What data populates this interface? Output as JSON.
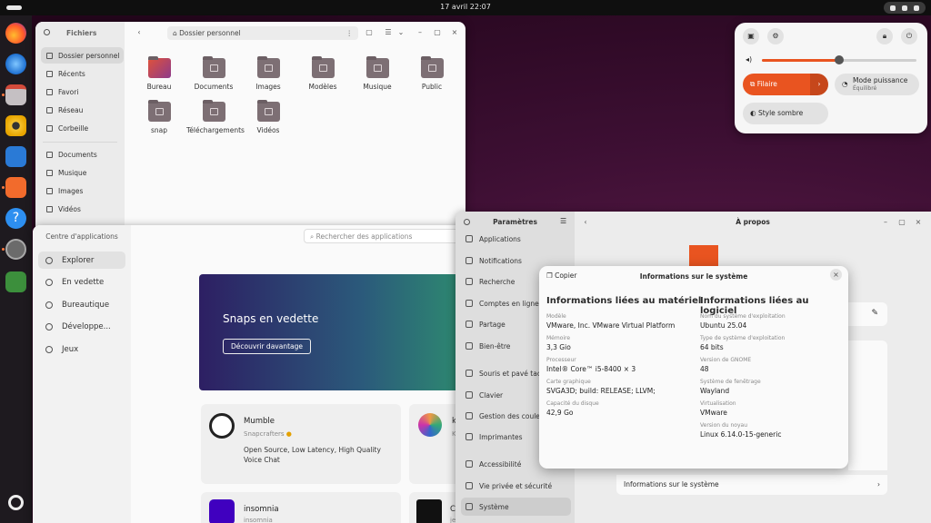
{
  "topbar": {
    "clock": "17 avril  22:07"
  },
  "dock": {
    "apps": [
      "Firefox",
      "Thunderbird",
      "Fichiers",
      "Rhythmbox",
      "LibreOffice Writer",
      "App Center",
      "Aide",
      "Paramètres",
      "Corbeille"
    ]
  },
  "files": {
    "title": "Fichiers",
    "path": "Dossier personnel",
    "places": [
      "Dossier personnel",
      "Récents",
      "Favori",
      "Réseau",
      "Corbeille"
    ],
    "bookmarks": [
      "Documents",
      "Musique",
      "Images",
      "Vidéos"
    ],
    "folders": [
      {
        "name": "Bureau",
        "icon": "desktop-folder-icon"
      },
      {
        "name": "Documents",
        "icon": "documents-folder-icon"
      },
      {
        "name": "Images",
        "icon": "pictures-folder-icon"
      },
      {
        "name": "Modèles",
        "icon": "templates-folder-icon"
      },
      {
        "name": "Musique",
        "icon": "music-folder-icon"
      },
      {
        "name": "Public",
        "icon": "public-folder-icon"
      },
      {
        "name": "snap",
        "icon": "folder-icon"
      },
      {
        "name": "Téléchargements",
        "icon": "downloads-folder-icon"
      },
      {
        "name": "Vidéos",
        "icon": "videos-folder-icon"
      }
    ]
  },
  "appcenter": {
    "title": "Centre d'applications",
    "search_placeholder": "Rechercher des applications",
    "nav": [
      "Explorer",
      "En vedette",
      "Bureautique",
      "Développe...",
      "Jeux"
    ],
    "banner": {
      "title": "Snaps en vedette",
      "button": "Découvrir davantage"
    },
    "apps": [
      {
        "name": "Mumble",
        "publisher": "Snapcrafters",
        "desc": "Open Source, Low Latency, High Quality Voice Chat"
      },
      {
        "name": "insomnia",
        "publisher": "insomnia"
      },
      {
        "name": "k",
        "publisher": "K"
      },
      {
        "name": "C",
        "publisher": "jetbrains"
      }
    ]
  },
  "settings": {
    "title": "Paramètres",
    "page_title": "À propos",
    "items": [
      "Applications",
      "Notifications",
      "Recherche",
      "Comptes en ligne",
      "Partage",
      "Bien-être",
      "Souris et pavé tactile",
      "Clavier",
      "Gestion des couleurs",
      "Imprimantes",
      "Accessibilité",
      "Vie privée et sécurité",
      "Système"
    ],
    "row_label": "Informations sur le système"
  },
  "sysinfo": {
    "copy": "Copier",
    "title": "Informations sur le système",
    "hw_heading": "Informations liées au matériel",
    "sw_heading": "Informations liées au logiciel",
    "hardware": [
      {
        "k": "Modèle",
        "v": "VMware, Inc. VMware Virtual Platform"
      },
      {
        "k": "Mémoire",
        "v": "3,3 Gio"
      },
      {
        "k": "Processeur",
        "v": "Intel® Core™ i5-8400 × 3"
      },
      {
        "k": "Carte graphique",
        "v": "SVGA3D; build: RELEASE; LLVM;"
      },
      {
        "k": "Capacité du disque",
        "v": "42,9 Go"
      }
    ],
    "software": [
      {
        "k": "Nom du système d'exploitation",
        "v": "Ubuntu 25.04"
      },
      {
        "k": "Type de système d'exploitation",
        "v": "64 bits"
      },
      {
        "k": "Version de GNOME",
        "v": "48"
      },
      {
        "k": "Système de fenêtrage",
        "v": "Wayland"
      },
      {
        "k": "Virtualisation",
        "v": "VMware"
      },
      {
        "k": "Version du noyau",
        "v": "Linux 6.14.0-15-generic"
      }
    ]
  },
  "quicksettings": {
    "volume": 0.5,
    "wired": "Filaire",
    "power_mode": "Mode puissance",
    "power_value": "Équilibré",
    "dark_style": "Style sombre",
    "accent": "#e95420"
  }
}
